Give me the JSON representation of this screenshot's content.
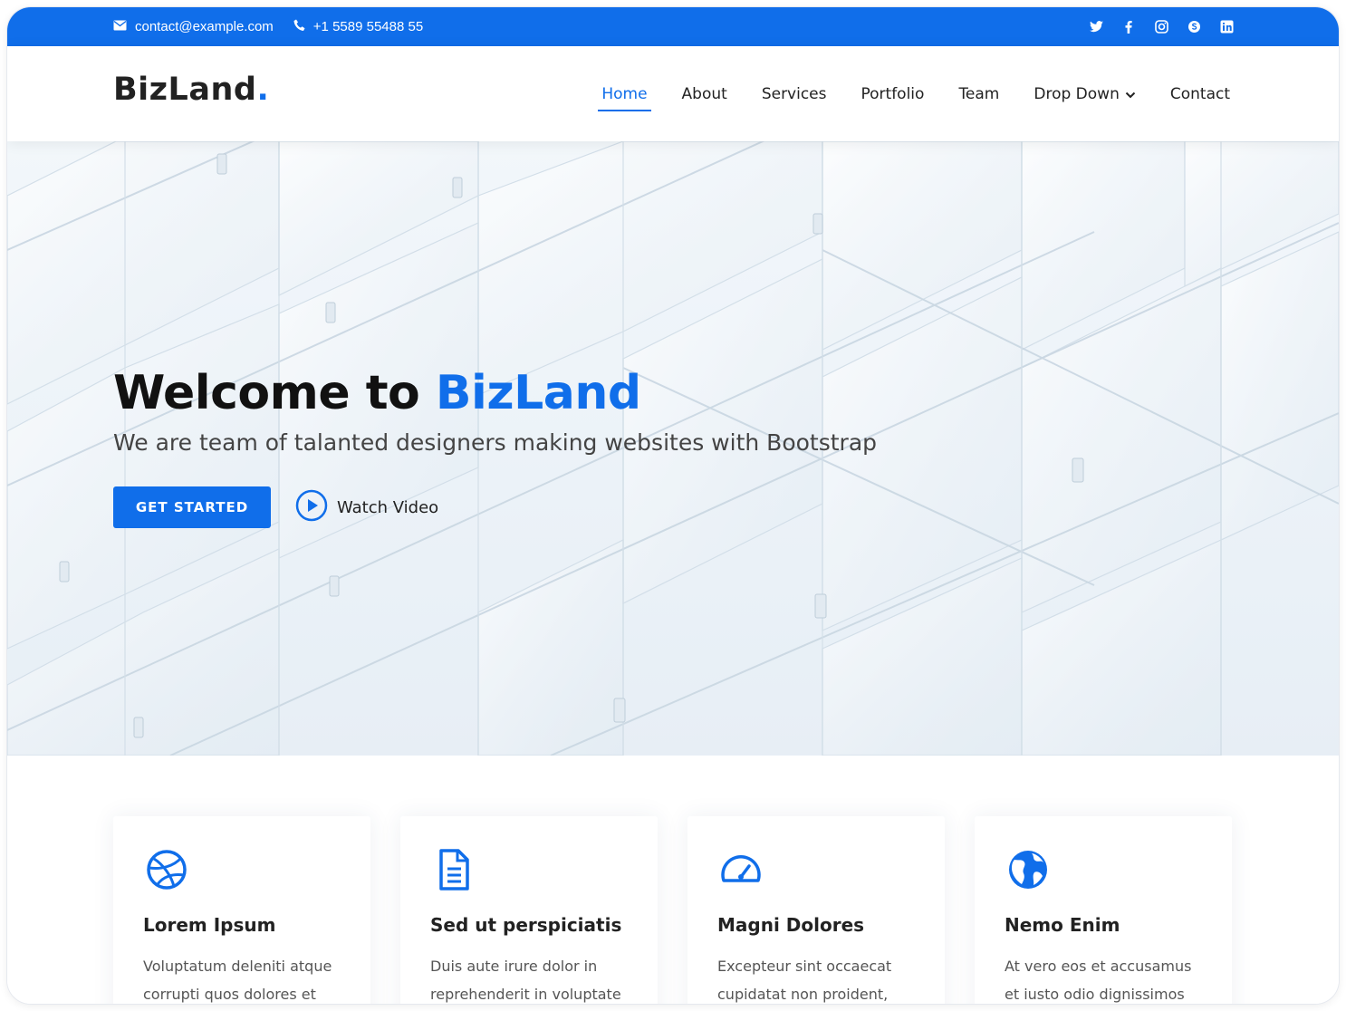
{
  "topbar": {
    "email": "contact@example.com",
    "phone": "+1 5589 55488 55",
    "social_icons": [
      "twitter-icon",
      "facebook-icon",
      "instagram-icon",
      "skype-icon",
      "linkedin-icon"
    ]
  },
  "header": {
    "logo_text": "BizLand",
    "logo_dot": ".",
    "nav": [
      {
        "label": "Home",
        "active": true
      },
      {
        "label": "About"
      },
      {
        "label": "Services"
      },
      {
        "label": "Portfolio"
      },
      {
        "label": "Team"
      },
      {
        "label": "Drop Down",
        "has_dropdown": true
      },
      {
        "label": "Contact"
      }
    ]
  },
  "hero": {
    "title_prefix": "Welcome to ",
    "title_accent": "BizLand",
    "subtitle": "We are team of talanted designers making websites with Bootstrap",
    "cta_label": "GET STARTED",
    "video_label": "Watch Video"
  },
  "services": [
    {
      "icon": "dribbble-icon",
      "title": "Lorem Ipsum",
      "description": "Voluptatum deleniti atque corrupti quos dolores et"
    },
    {
      "icon": "file-icon",
      "title": "Sed ut perspiciatis",
      "description": "Duis aute irure dolor in reprehenderit in voluptate"
    },
    {
      "icon": "speedometer-icon",
      "title": "Magni Dolores",
      "description": "Excepteur sint occaecat cupidatat non proident,"
    },
    {
      "icon": "globe-icon",
      "title": "Nemo Enim",
      "description": "At vero eos et accusamus et iusto odio dignissimos"
    }
  ],
  "colors": {
    "primary": "#106eea",
    "text_dark": "#222222"
  }
}
